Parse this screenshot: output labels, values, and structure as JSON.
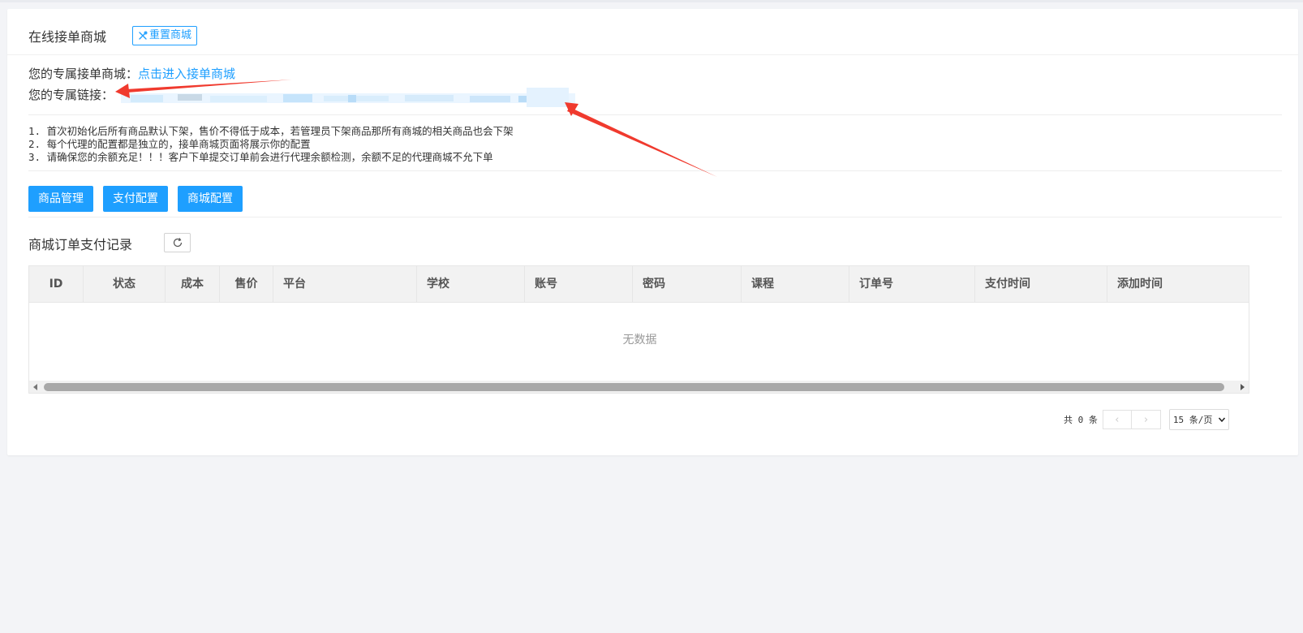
{
  "header": {
    "title": "在线接单商城",
    "reset_button": "重置商城"
  },
  "info": {
    "mall_label": "您的专属接单商城：",
    "mall_link": "点击进入接单商城",
    "link_label": "您的专属链接："
  },
  "notes": [
    "1. 首次初始化后所有商品默认下架，售价不得低于成本，若管理员下架商品那所有商城的相关商品也会下架",
    "2. 每个代理的配置都是独立的，接单商城页面将展示你的配置",
    "3. 请确保您的余额充足！！！客户下单提交订单前会进行代理余额检测，余额不足的代理商城不允下单"
  ],
  "actions": {
    "goods": "商品管理",
    "payment": "支付配置",
    "mall": "商城配置"
  },
  "records": {
    "title": "商城订单支付记录",
    "refresh_icon": "refresh-icon"
  },
  "table": {
    "columns": [
      "ID",
      "状态",
      "成本",
      "售价",
      "平台",
      "学校",
      "账号",
      "密码",
      "课程",
      "订单号",
      "支付时间",
      "添加时间"
    ],
    "empty_text": "无数据"
  },
  "pager": {
    "total": "共 0 条",
    "page_size": "15 条/页"
  },
  "colors": {
    "accent": "#1e9fff",
    "annotation_arrow": "#f03a2e"
  }
}
